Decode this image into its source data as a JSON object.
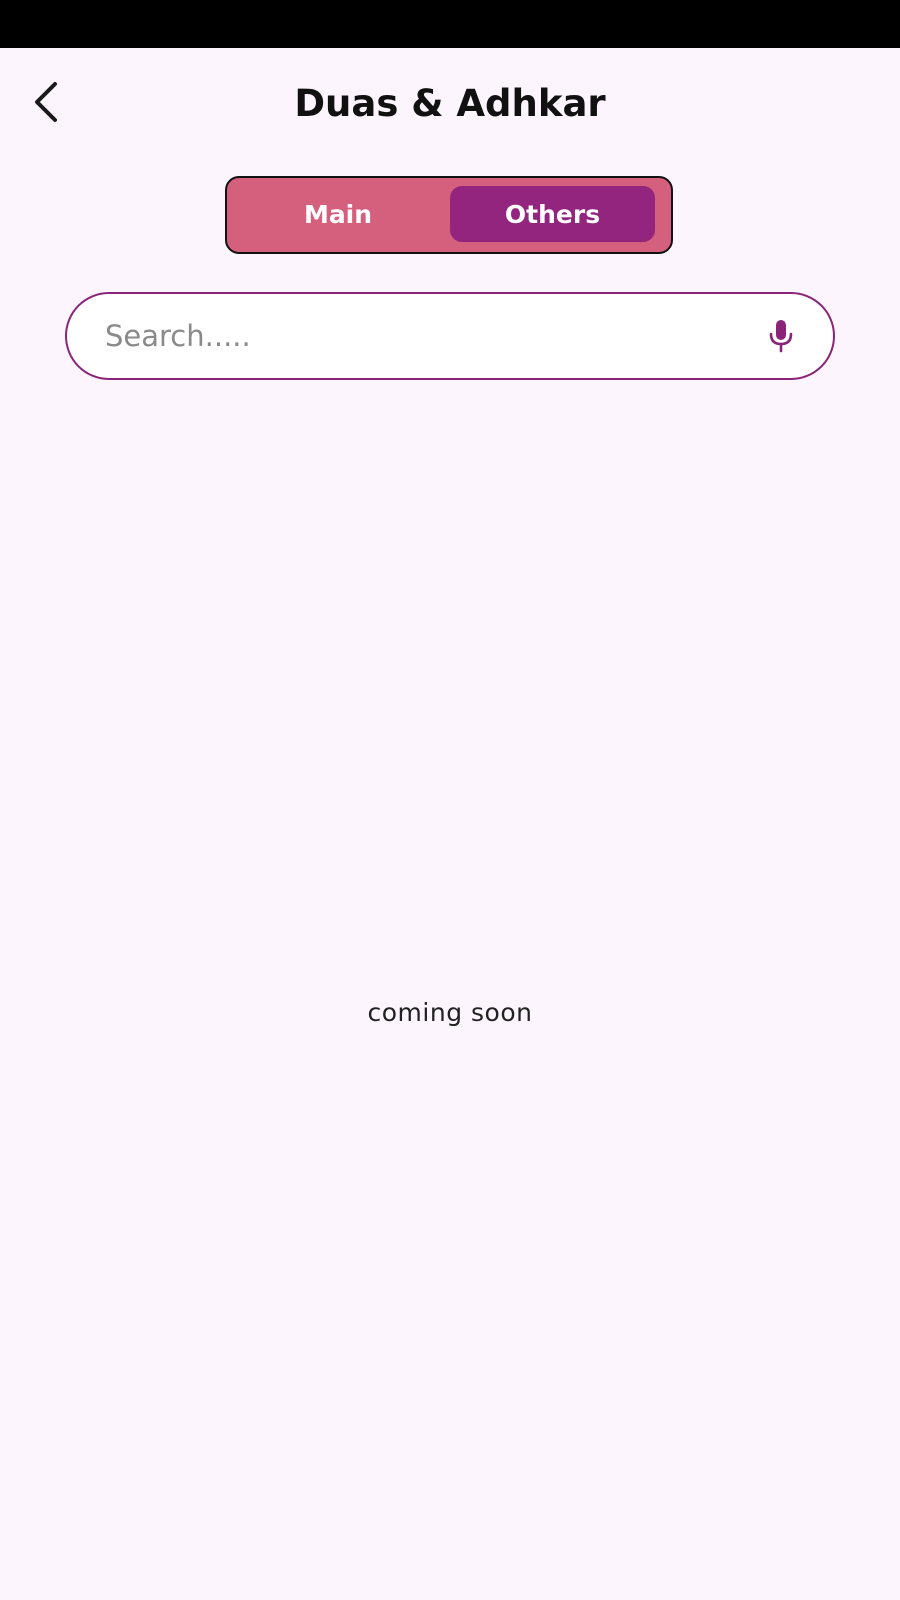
{
  "header": {
    "title": "Duas & Adhkar",
    "back_icon": "chevron-left-icon"
  },
  "tabs": [
    {
      "label": "Main",
      "selected": false
    },
    {
      "label": "Others",
      "selected": true
    }
  ],
  "search": {
    "value": "",
    "placeholder": "Search.....",
    "mic_icon": "microphone-icon"
  },
  "content": {
    "empty_message": "coming soon"
  },
  "colors": {
    "background": "#FDF5FD",
    "segment_bg": "#D4607E",
    "segment_active": "#93257F",
    "accent": "#8A2479"
  }
}
